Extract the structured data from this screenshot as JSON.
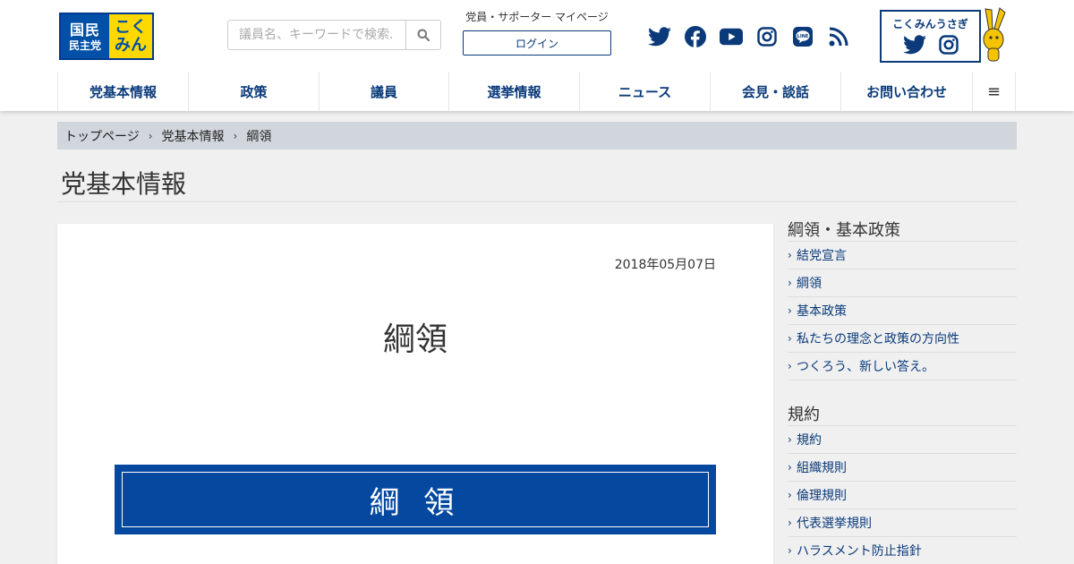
{
  "header": {
    "logo": {
      "left_line1": "国民",
      "left_line2": "民主党",
      "right_line1": "こく",
      "right_line2": "みん",
      "colors": {
        "navy": "#0050a8",
        "yellow": "#ffd800"
      }
    },
    "search": {
      "placeholder": "議員名、キーワードで検索..."
    },
    "mypage_label": "党員・サポーター マイページ",
    "login_label": "ログイン",
    "social_icons": [
      "twitter-icon",
      "facebook-icon",
      "youtube-icon",
      "instagram-icon",
      "line-icon",
      "rss-icon"
    ],
    "usagi": {
      "title": "こくみんうさぎ"
    }
  },
  "nav": {
    "items": [
      {
        "label": "党基本情報"
      },
      {
        "label": "政策"
      },
      {
        "label": "議員"
      },
      {
        "label": "選挙情報"
      },
      {
        "label": "ニュース"
      },
      {
        "label": "会見・談話"
      },
      {
        "label": "お問い合わせ"
      }
    ],
    "menu_icon": "≡"
  },
  "breadcrumb": [
    "トップページ",
    "党基本情報",
    "綱領"
  ],
  "page_title": "党基本情報",
  "article": {
    "date": "2018年05月07日",
    "title": "綱領",
    "banner_text": "綱 領"
  },
  "sidebar": {
    "sections": [
      {
        "heading": "綱領・基本政策",
        "items": [
          "結党宣言",
          "綱領",
          "基本政策",
          "私たちの理念と政策の方向性",
          "つくろう、新しい答え。"
        ]
      },
      {
        "heading": "規約",
        "items": [
          "規約",
          "組織規則",
          "倫理規則",
          "代表選挙規則",
          "ハラスメント防止指針"
        ]
      }
    ]
  },
  "colors": {
    "brand_navy": "#0a3a7a",
    "banner_blue": "#0548a0",
    "breadcrumb_bg": "#d1d6dc"
  }
}
